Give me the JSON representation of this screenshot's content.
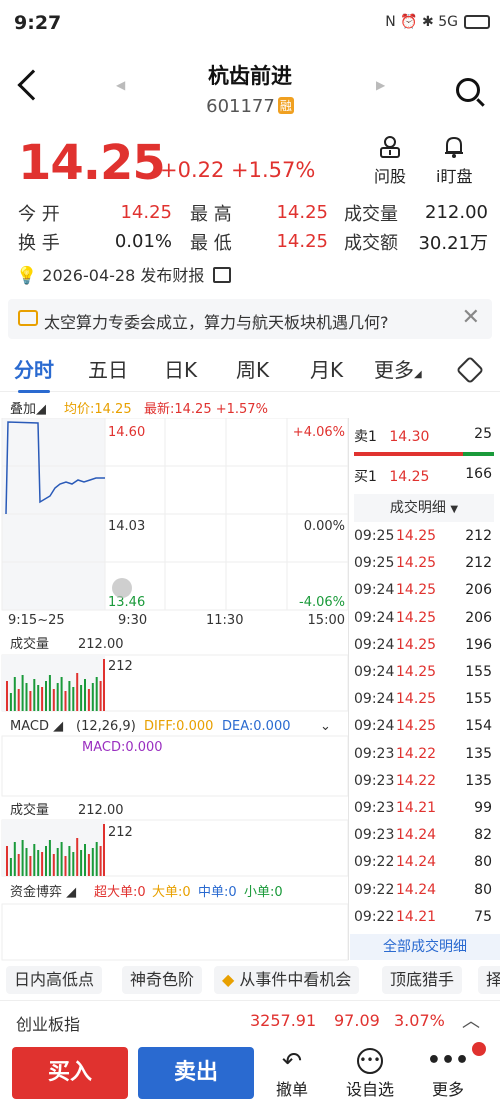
{
  "status_bar": {
    "time": "9:27",
    "right_icons": "N ⏰ ✱ 5G"
  },
  "header": {
    "title": "杭齿前进",
    "code": "601177",
    "badge": "融"
  },
  "quote": {
    "price": "14.25",
    "change": "+0.22",
    "change_pct": "+1.57%"
  },
  "tools": [
    {
      "label": "问股",
      "icon": "ask-stock-icon"
    },
    {
      "label": "i盯盘",
      "icon": "bell-icon"
    }
  ],
  "stats": {
    "open_label": "今 开",
    "open": "14.25",
    "high_label": "最 高",
    "high": "14.25",
    "vol_label": "成交量",
    "vol": "212.00",
    "turnover_label": "换 手",
    "turnover": "0.01%",
    "low_label": "最 低",
    "low": "14.25",
    "amount_label": "成交额",
    "amount": "30.21万"
  },
  "report": {
    "text": "2026-04-28 发布财报"
  },
  "news": {
    "text": "太空算力专委会成立，算力与航天板块机遇几何?"
  },
  "tabs": [
    "分时",
    "五日",
    "日K",
    "周K",
    "月K",
    "更多"
  ],
  "chart_info": {
    "overlay": "叠加",
    "avg": "均价:14.25",
    "latest": "最新:14.25 +1.57%"
  },
  "price_chart": {
    "y_top": "14.60",
    "y_mid": "14.03",
    "y_bottom": "13.46",
    "pct_top": "+4.06%",
    "pct_mid": "0.00%",
    "pct_bottom": "-4.06%",
    "x_labels": [
      "9:15~25",
      "9:30",
      "11:30",
      "15:00"
    ]
  },
  "vol_panel": {
    "label": "成交量",
    "value": "212.00",
    "axis": "212"
  },
  "macd_panel": {
    "label": "MACD",
    "params": "(12,26,9)",
    "diff": "DIFF:0.000",
    "dea": "DEA:0.000",
    "macd": "MACD:0.000"
  },
  "vol_panel2": {
    "label": "成交量",
    "value": "212.00",
    "axis": "212"
  },
  "fund_panel": {
    "label": "资金博弈",
    "super": "超大单:0",
    "big": "大单:0",
    "mid": "中单:0",
    "small": "小单:0"
  },
  "order_book": {
    "sell_label": "卖1",
    "sell_price": "14.30",
    "sell_vol": "25",
    "buy_label": "买1",
    "buy_price": "14.25",
    "buy_vol": "166"
  },
  "ticks_header": "成交明细",
  "ticks": [
    {
      "t": "09:25",
      "p": "14.25",
      "v": "212"
    },
    {
      "t": "09:25",
      "p": "14.25",
      "v": "212"
    },
    {
      "t": "09:24",
      "p": "14.25",
      "v": "206"
    },
    {
      "t": "09:24",
      "p": "14.25",
      "v": "206"
    },
    {
      "t": "09:24",
      "p": "14.25",
      "v": "196"
    },
    {
      "t": "09:24",
      "p": "14.25",
      "v": "155"
    },
    {
      "t": "09:24",
      "p": "14.25",
      "v": "155"
    },
    {
      "t": "09:24",
      "p": "14.25",
      "v": "154"
    },
    {
      "t": "09:23",
      "p": "14.22",
      "v": "135"
    },
    {
      "t": "09:23",
      "p": "14.22",
      "v": "135"
    },
    {
      "t": "09:23",
      "p": "14.21",
      "v": "99"
    },
    {
      "t": "09:23",
      "p": "14.24",
      "v": "82"
    },
    {
      "t": "09:22",
      "p": "14.24",
      "v": "80"
    },
    {
      "t": "09:22",
      "p": "14.24",
      "v": "80"
    },
    {
      "t": "09:22",
      "p": "14.21",
      "v": "75"
    }
  ],
  "all_ticks_link": "全部成交明细",
  "features": [
    "日内高低点",
    "神奇色阶",
    "从事件中看机会",
    "顶底猎手",
    "择"
  ],
  "index": {
    "name": "创业板指",
    "value": "3257.91",
    "change": "97.09",
    "pct": "3.07%"
  },
  "actions": {
    "buy": "买入",
    "sell": "卖出",
    "undo": "撤单",
    "watch": "设自选",
    "more": "更多"
  },
  "colors": {
    "up": "#e0322f",
    "down": "#1a9a3a",
    "accent": "#2a6ad0"
  }
}
